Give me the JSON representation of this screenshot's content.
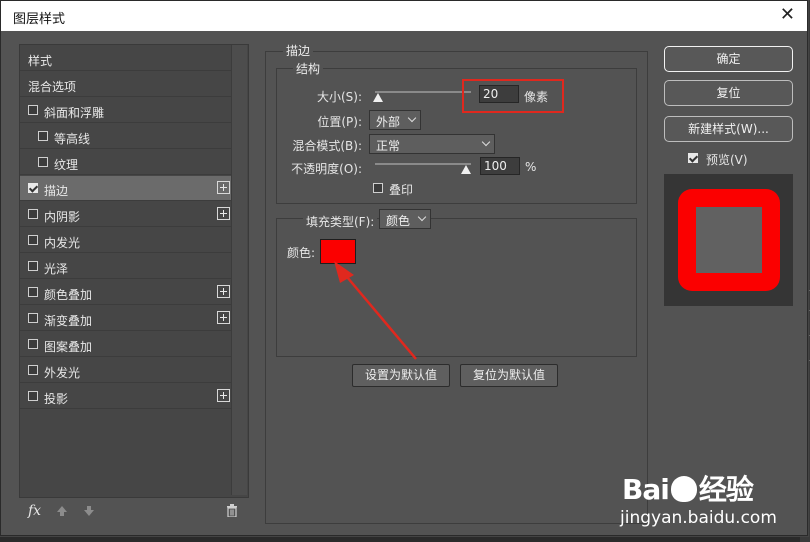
{
  "dialog": {
    "title": "图层样式"
  },
  "styles_list": {
    "items": [
      {
        "label": "样式",
        "checkbox": false,
        "plus": false,
        "indent": false,
        "checked": false,
        "selected": false
      },
      {
        "label": "混合选项",
        "checkbox": false,
        "plus": false,
        "indent": false,
        "checked": false,
        "selected": false
      },
      {
        "label": "斜面和浮雕",
        "checkbox": true,
        "plus": false,
        "indent": false,
        "checked": false,
        "selected": false
      },
      {
        "label": "等高线",
        "checkbox": true,
        "plus": false,
        "indent": true,
        "checked": false,
        "selected": false
      },
      {
        "label": "纹理",
        "checkbox": true,
        "plus": false,
        "indent": true,
        "checked": false,
        "selected": false
      },
      {
        "label": "描边",
        "checkbox": true,
        "plus": true,
        "indent": false,
        "checked": true,
        "selected": true
      },
      {
        "label": "内阴影",
        "checkbox": true,
        "plus": true,
        "indent": false,
        "checked": false,
        "selected": false
      },
      {
        "label": "内发光",
        "checkbox": true,
        "plus": false,
        "indent": false,
        "checked": false,
        "selected": false
      },
      {
        "label": "光泽",
        "checkbox": true,
        "plus": false,
        "indent": false,
        "checked": false,
        "selected": false
      },
      {
        "label": "颜色叠加",
        "checkbox": true,
        "plus": true,
        "indent": false,
        "checked": false,
        "selected": false
      },
      {
        "label": "渐变叠加",
        "checkbox": true,
        "plus": true,
        "indent": false,
        "checked": false,
        "selected": false
      },
      {
        "label": "图案叠加",
        "checkbox": true,
        "plus": false,
        "indent": false,
        "checked": false,
        "selected": false
      },
      {
        "label": "外发光",
        "checkbox": true,
        "plus": false,
        "indent": false,
        "checked": false,
        "selected": false
      },
      {
        "label": "投影",
        "checkbox": true,
        "plus": true,
        "indent": false,
        "checked": false,
        "selected": false
      }
    ],
    "footer": {
      "fx": "fx"
    }
  },
  "stroke": {
    "section_title": "描边",
    "structure": {
      "title": "结构",
      "size_label": "大小(S):",
      "size_value": "20",
      "size_unit": "像素",
      "size_slider": 0.03,
      "position_label": "位置(P):",
      "position_value": "外部",
      "blend_label": "混合模式(B):",
      "blend_value": "正常",
      "opacity_label": "不透明度(O):",
      "opacity_value": "100",
      "opacity_unit": "%",
      "opacity_slider": 1.0,
      "overprint_label": "叠印"
    },
    "fill": {
      "type_label": "填充类型(F):",
      "type_value": "颜色",
      "color_label": "颜色:",
      "color": "#fb0000"
    },
    "set_default_btn": "设置为默认值",
    "reset_default_btn": "复位为默认值"
  },
  "actions": {
    "ok": "确定",
    "reset": "复位",
    "new_style": "新建样式(W)...",
    "preview_label": "预览(V)",
    "preview_checked": true
  },
  "annotation": {
    "highlight_color": "#e0281e"
  },
  "watermark": {
    "brand_a": "Bai",
    "brand_b": "经验",
    "url": "jingyan.baidu.com"
  }
}
